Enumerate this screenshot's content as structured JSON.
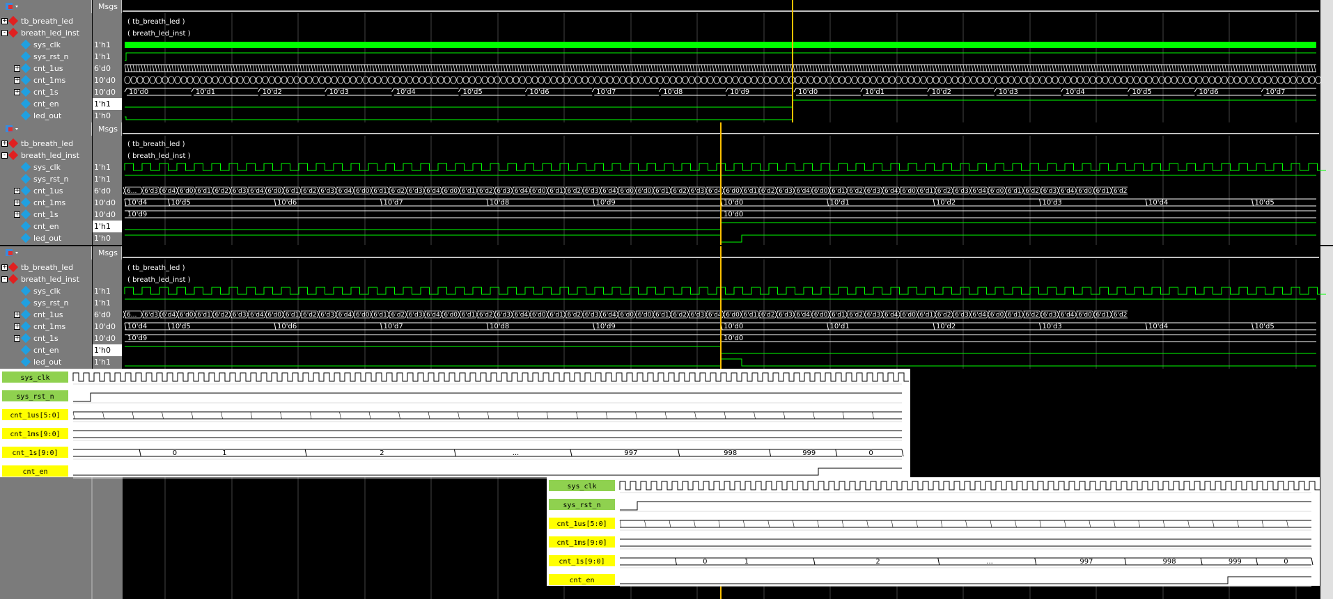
{
  "header": {
    "msgs": "Msgs"
  },
  "panes": [
    {
      "id": "pane1",
      "signals": [
        {
          "name": "tb_breath_led",
          "value": "",
          "icon": "module-icon",
          "expand": "+",
          "indent": 0
        },
        {
          "name": "breath_led_inst",
          "value": "",
          "icon": "module-icon",
          "expand": "-",
          "indent": 0
        },
        {
          "name": "sys_clk",
          "value": "1'h1",
          "icon": "signal-icon",
          "expand": "",
          "indent": 1
        },
        {
          "name": "sys_rst_n",
          "value": "1'h1",
          "icon": "signal-icon",
          "expand": "",
          "indent": 1
        },
        {
          "name": "cnt_1us",
          "value": "6'd0",
          "icon": "signal-icon",
          "expand": "+",
          "indent": 1
        },
        {
          "name": "cnt_1ms",
          "value": "10'd0",
          "icon": "signal-icon",
          "expand": "+",
          "indent": 1
        },
        {
          "name": "cnt_1s",
          "value": "10'd0",
          "icon": "signal-icon",
          "expand": "+",
          "indent": 1
        },
        {
          "name": "cnt_en",
          "value": "1'h1",
          "icon": "signal-icon",
          "expand": "",
          "indent": 1,
          "selected": true
        },
        {
          "name": "led_out",
          "value": "1'h0",
          "icon": "signal-icon",
          "expand": "",
          "indent": 1
        }
      ],
      "wave_labels": [
        "( tb_breath_led )",
        "( breath_led_inst )"
      ],
      "bus_1s": [
        "10'd0",
        "10'd1",
        "10'd2",
        "10'd3",
        "10'd4",
        "10'd5",
        "10'd6",
        "10'd7",
        "10'd8",
        "10'd9",
        "10'd0",
        "10'd1",
        "10'd2",
        "10'd3",
        "10'd4",
        "10'd5",
        "10'd6",
        "10'd7"
      ]
    },
    {
      "id": "pane2",
      "signals": [
        {
          "name": "tb_breath_led",
          "value": "",
          "icon": "module-icon",
          "expand": "+",
          "indent": 0
        },
        {
          "name": "breath_led_inst",
          "value": "",
          "icon": "module-icon",
          "expand": "-",
          "indent": 0
        },
        {
          "name": "sys_clk",
          "value": "1'h1",
          "icon": "signal-icon",
          "expand": "",
          "indent": 1
        },
        {
          "name": "sys_rst_n",
          "value": "1'h1",
          "icon": "signal-icon",
          "expand": "",
          "indent": 1
        },
        {
          "name": "cnt_1us",
          "value": "6'd0",
          "icon": "signal-icon",
          "expand": "+",
          "indent": 1
        },
        {
          "name": "cnt_1ms",
          "value": "10'd0",
          "icon": "signal-icon",
          "expand": "+",
          "indent": 1
        },
        {
          "name": "cnt_1s",
          "value": "10'd0",
          "icon": "signal-icon",
          "expand": "+",
          "indent": 1
        },
        {
          "name": "cnt_en",
          "value": "1'h1",
          "icon": "signal-icon",
          "expand": "",
          "indent": 1,
          "selected": true
        },
        {
          "name": "led_out",
          "value": "1'h0",
          "icon": "signal-icon",
          "expand": "",
          "indent": 1
        }
      ],
      "wave_labels": [
        "( tb_breath_led )",
        "( breath_led_inst )"
      ],
      "bus_1us": [
        "6...",
        "6'd3",
        "6'd4",
        "6'd0",
        "6'd1",
        "6'd2",
        "6'd3",
        "6'd4",
        "6'd0",
        "6'd1",
        "6'd2",
        "6'd3",
        "6'd4",
        "6'd0",
        "6'd1",
        "6'd2",
        "6'd3",
        "6'd4",
        "6'd0",
        "6'd1",
        "6'd2",
        "6'd3",
        "6'd4",
        "6'd0",
        "6'd1",
        "6'd2",
        "6'd3",
        "6'd4",
        "6'd0",
        "6'd0",
        "6'd1",
        "6'd2",
        "6'd3",
        "6'd4",
        "6'd0",
        "6'd1",
        "6'd2",
        "6'd3",
        "6'd4",
        "6'd0",
        "6'd1",
        "6'd2",
        "6'd3",
        "6'd4",
        "6'd0",
        "6'd1",
        "6'd2",
        "6'd3",
        "6'd4",
        "6'd0",
        "6'd1",
        "6'd2",
        "6'd3",
        "6'd4",
        "6'd0",
        "6'd1",
        "6'd2"
      ],
      "bus_1ms": [
        "10'd4",
        "10'd5",
        "10'd6",
        "10'd7",
        "10'd8",
        "10'd9",
        "10'd0",
        "10'd1",
        "10'd2",
        "10'd3",
        "10'd4",
        "10'd5"
      ],
      "bus_1s": [
        "10'd9",
        "10'd0"
      ]
    },
    {
      "id": "pane3",
      "signals": [
        {
          "name": "tb_breath_led",
          "value": "",
          "icon": "module-icon",
          "expand": "+",
          "indent": 0
        },
        {
          "name": "breath_led_inst",
          "value": "",
          "icon": "module-icon",
          "expand": "-",
          "indent": 0
        },
        {
          "name": "sys_clk",
          "value": "1'h1",
          "icon": "signal-icon",
          "expand": "",
          "indent": 1
        },
        {
          "name": "sys_rst_n",
          "value": "1'h1",
          "icon": "signal-icon",
          "expand": "",
          "indent": 1
        },
        {
          "name": "cnt_1us",
          "value": "6'd0",
          "icon": "signal-icon",
          "expand": "+",
          "indent": 1
        },
        {
          "name": "cnt_1ms",
          "value": "10'd0",
          "icon": "signal-icon",
          "expand": "+",
          "indent": 1
        },
        {
          "name": "cnt_1s",
          "value": "10'd0",
          "icon": "signal-icon",
          "expand": "+",
          "indent": 1
        },
        {
          "name": "cnt_en",
          "value": "1'h0",
          "icon": "signal-icon",
          "expand": "",
          "indent": 1,
          "selected": true
        },
        {
          "name": "led_out",
          "value": "1'h1",
          "icon": "signal-icon",
          "expand": "",
          "indent": 1
        }
      ],
      "wave_labels": [
        "( tb_breath_led )",
        "( breath_led_inst )"
      ],
      "bus_1us": [
        "6...",
        "6'd3",
        "6'd4",
        "6'd0",
        "6'd1",
        "6'd2",
        "6'd3",
        "6'd4",
        "6'd0",
        "6'd1",
        "6'd2",
        "6'd3",
        "6'd4",
        "6'd0",
        "6'd1",
        "6'd2",
        "6'd3",
        "6'd4",
        "6'd0",
        "6'd1",
        "6'd2",
        "6'd3",
        "6'd4",
        "6'd0",
        "6'd1",
        "6'd2",
        "6'd3",
        "6'd4",
        "6'd0",
        "6'd0",
        "6'd1",
        "6'd2",
        "6'd3",
        "6'd4",
        "6'd0",
        "6'd1",
        "6'd2",
        "6'd3",
        "6'd4",
        "6'd0",
        "6'd1",
        "6'd2",
        "6'd3",
        "6'd4",
        "6'd0",
        "6'd1",
        "6'd2",
        "6'd3",
        "6'd4",
        "6'd0",
        "6'd1",
        "6'd2",
        "6'd3",
        "6'd4",
        "6'd0",
        "6'd1",
        "6'd2"
      ],
      "bus_1ms": [
        "10'd4",
        "10'd5",
        "10'd6",
        "10'd7",
        "10'd8",
        "10'd9",
        "10'd0",
        "10'd1",
        "10'd2",
        "10'd3",
        "10'd4",
        "10'd5"
      ],
      "bus_1s": [
        "10'd9",
        "10'd0"
      ]
    }
  ],
  "timing_diagrams": [
    {
      "id": "td1",
      "labels": [
        "sys_clk",
        "sys_rst_n",
        "cnt_1us[5:0]",
        "cnt_1ms[9:0]",
        "cnt_1s[9:0]",
        "cnt_en"
      ],
      "label_colors": [
        "#8fd14f",
        "#8fd14f",
        "#ffff00",
        "#ffff00",
        "#ffff00",
        "#ffff00"
      ],
      "cnt_1s_values": [
        "0",
        "1",
        "2",
        "...",
        "997",
        "998",
        "999",
        "0"
      ]
    },
    {
      "id": "td2",
      "labels": [
        "sys_clk",
        "sys_rst_n",
        "cnt_1us[5:0]",
        "cnt_1ms[9:0]",
        "cnt_1s[9:0]",
        "cnt_en"
      ],
      "label_colors": [
        "#8fd14f",
        "#8fd14f",
        "#ffff00",
        "#ffff00",
        "#ffff00",
        "#ffff00"
      ],
      "cnt_1s_values": [
        "0",
        "1",
        "2",
        "...",
        "997",
        "998",
        "999",
        "0"
      ]
    }
  ],
  "colors": {
    "wave": "#00ff00",
    "cursor": "#ffc000",
    "grid": "#555555",
    "panel": "#7b7b7b"
  }
}
